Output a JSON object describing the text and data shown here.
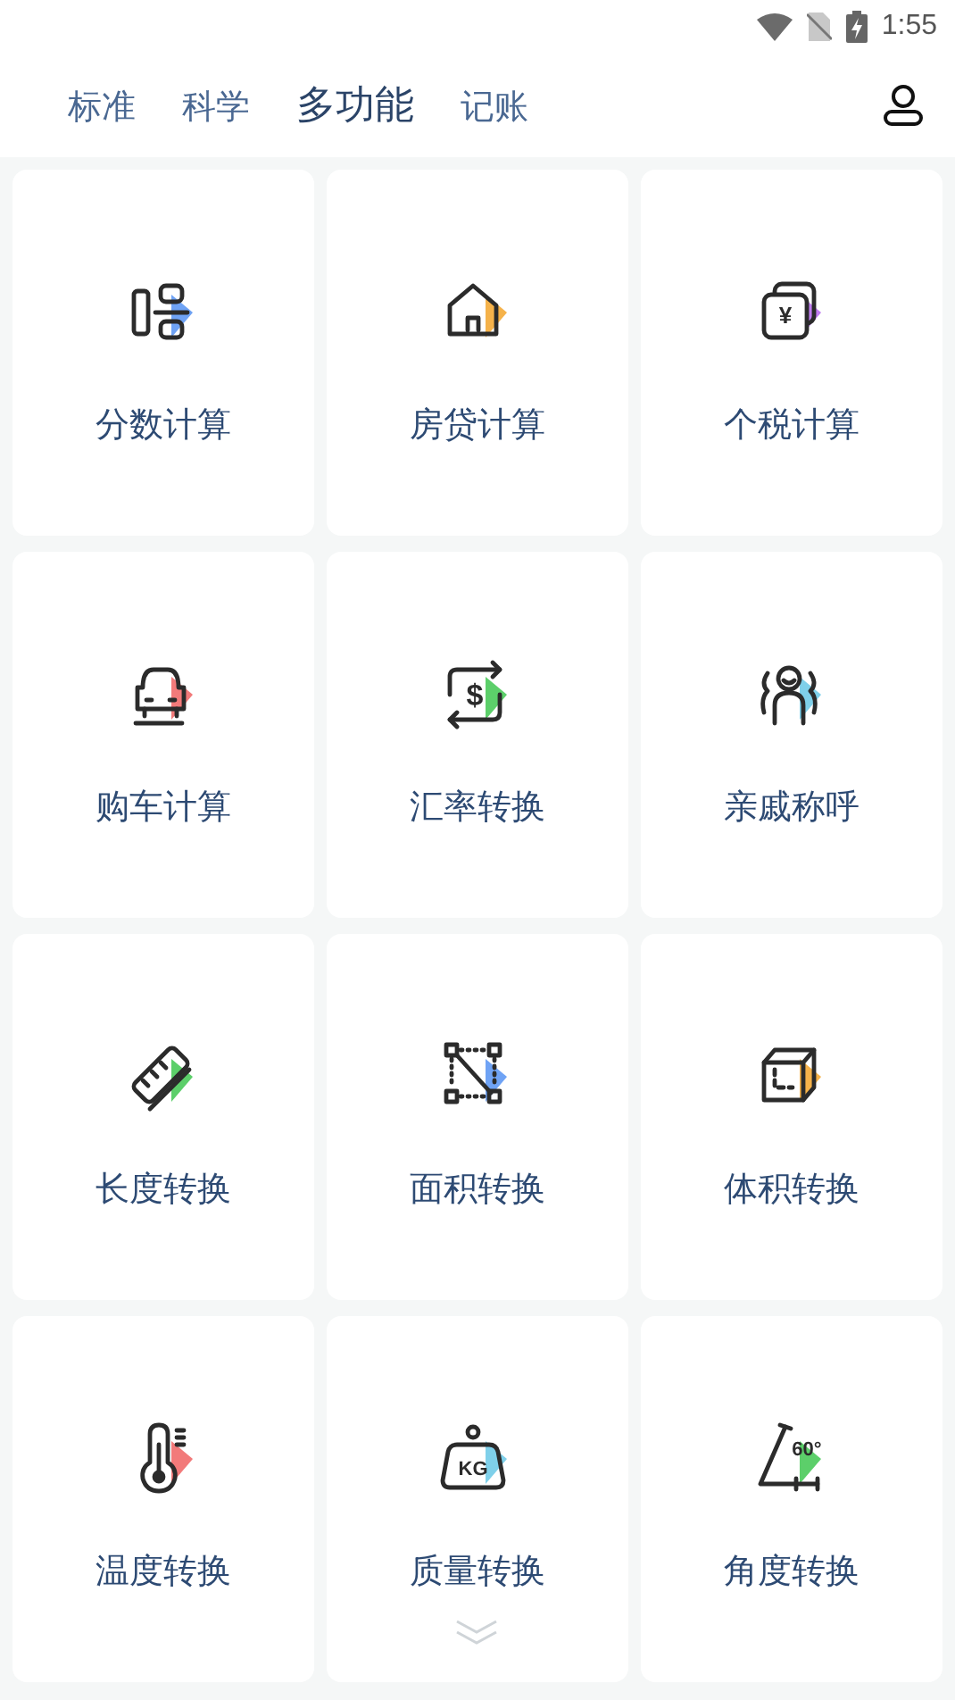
{
  "status_bar": {
    "time": "1:55"
  },
  "tabs": [
    {
      "label": "标准",
      "selected": false
    },
    {
      "label": "科学",
      "selected": false
    },
    {
      "label": "多功能",
      "selected": true
    },
    {
      "label": "记账",
      "selected": false
    }
  ],
  "tools": [
    {
      "label": "分数计算",
      "color": "#6fa3f5"
    },
    {
      "label": "房贷计算",
      "color": "#f5b24a"
    },
    {
      "label": "个税计算",
      "icon_text": "¥",
      "color": "#c07cf0"
    },
    {
      "label": "购车计算",
      "color": "#f27a7a"
    },
    {
      "label": "汇率转换",
      "icon_text": "$",
      "color": "#5ccf6a"
    },
    {
      "label": "亲戚称呼",
      "color": "#7fd0ea"
    },
    {
      "label": "长度转换",
      "color": "#5ccf6a"
    },
    {
      "label": "面积转换",
      "color": "#6fa3f5"
    },
    {
      "label": "体积转换",
      "color": "#f5b24a"
    },
    {
      "label": "温度转换",
      "color": "#f27a7a"
    },
    {
      "label": "质量转换",
      "icon_text": "KG",
      "color": "#7fd0ea"
    },
    {
      "label": "角度转换",
      "icon_text": "60°",
      "color": "#5ccf6a"
    }
  ]
}
